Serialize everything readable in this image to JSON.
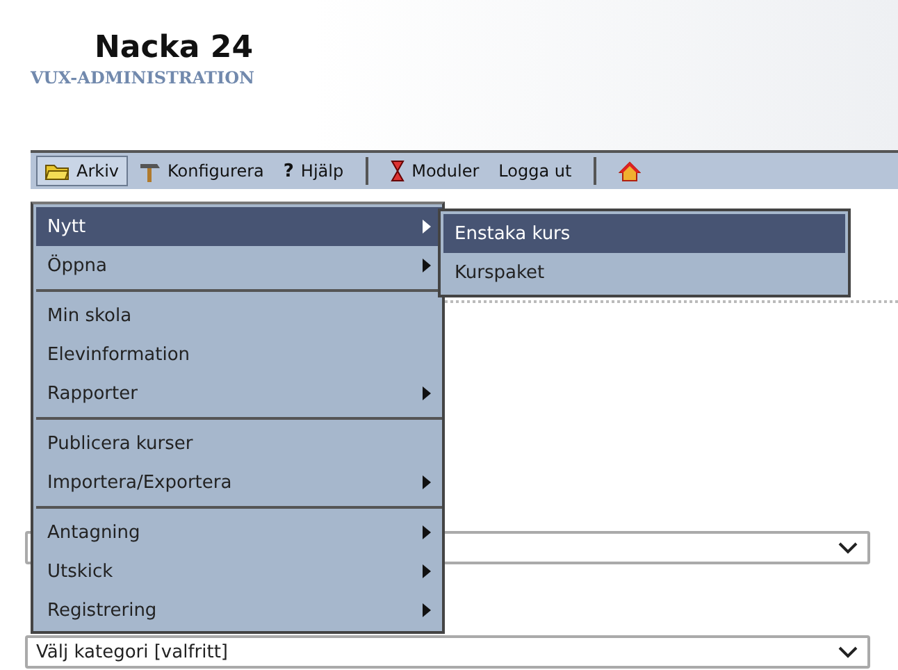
{
  "header": {
    "title": "Nacka 24",
    "subtitle": "VUX-ADMINISTRATION"
  },
  "toolbar": [
    {
      "kind": "folder",
      "label": "Arkiv",
      "selected": true
    },
    {
      "kind": "hammer",
      "label": "Konfigurera",
      "selected": false
    },
    {
      "kind": "help",
      "glyph": "?",
      "label": "Hjälp",
      "selected": false
    },
    {
      "kind": "separator"
    },
    {
      "kind": "hourglass",
      "label": "Moduler",
      "selected": false
    },
    {
      "kind": "text",
      "label": "Logga ut",
      "selected": false
    },
    {
      "kind": "separator"
    },
    {
      "kind": "home",
      "selected": false
    }
  ],
  "menu": [
    [
      {
        "label": "Nytt",
        "submenu": true,
        "selected": true
      },
      {
        "label": "Öppna",
        "submenu": true,
        "selected": false
      }
    ],
    [
      {
        "label": "Min skola",
        "submenu": false,
        "selected": false
      },
      {
        "label": "Elevinformation",
        "submenu": false,
        "selected": false
      },
      {
        "label": "Rapporter",
        "submenu": true,
        "selected": false
      }
    ],
    [
      {
        "label": "Publicera kurser",
        "submenu": false,
        "selected": false
      },
      {
        "label": "Importera/Exportera",
        "submenu": true,
        "selected": false
      }
    ],
    [
      {
        "label": "Antagning",
        "submenu": true,
        "selected": false
      },
      {
        "label": "Utskick",
        "submenu": true,
        "selected": false
      },
      {
        "label": "Registrering",
        "submenu": true,
        "selected": false
      }
    ]
  ],
  "submenu": [
    {
      "label": "Enstaka kurs",
      "selected": true
    },
    {
      "label": "Kurspaket",
      "selected": false
    }
  ],
  "selects": [
    {
      "kind": "blank"
    },
    {
      "kind": "filled",
      "value": "Välj kategori [valfritt]"
    }
  ]
}
